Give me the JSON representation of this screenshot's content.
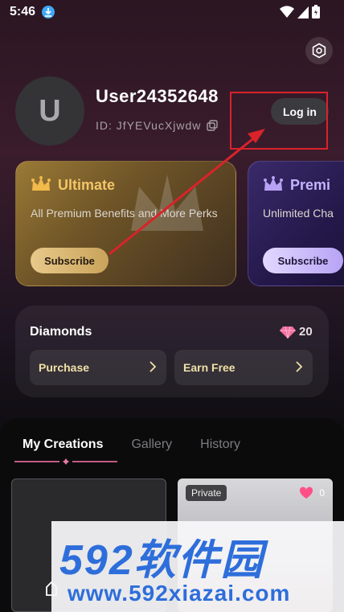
{
  "status_bar": {
    "time": "5:46"
  },
  "profile": {
    "avatar_letter": "U",
    "username": "User24352648",
    "id_text": "ID: JfYEVucXjwdw",
    "login_label": "Log in"
  },
  "cards": [
    {
      "title": "Ultimate",
      "description": "All Premium Benefits and More Perks",
      "button": "Subscribe",
      "accent": "#f3c567"
    },
    {
      "title": "Premi",
      "description": "Unlimited Cha",
      "button": "Subscribe",
      "accent": "#c5b3ff"
    }
  ],
  "diamonds": {
    "label": "Diamonds",
    "count": "20",
    "purchase_label": "Purchase",
    "earn_label": "Earn Free"
  },
  "tabs": [
    {
      "label": "My Creations",
      "active": true
    },
    {
      "label": "Gallery",
      "active": false
    },
    {
      "label": "History",
      "active": false
    }
  ],
  "creations": [
    {
      "badge": ""
    },
    {
      "badge": "Private",
      "likes": "0"
    }
  ],
  "watermark": {
    "brand_top": "592软件园",
    "url": "www.592xiazai.com"
  },
  "colors": {
    "highlight_box": "#d9232a",
    "arrow": "#d9232a",
    "watermark_blue": "#2e6edb"
  }
}
